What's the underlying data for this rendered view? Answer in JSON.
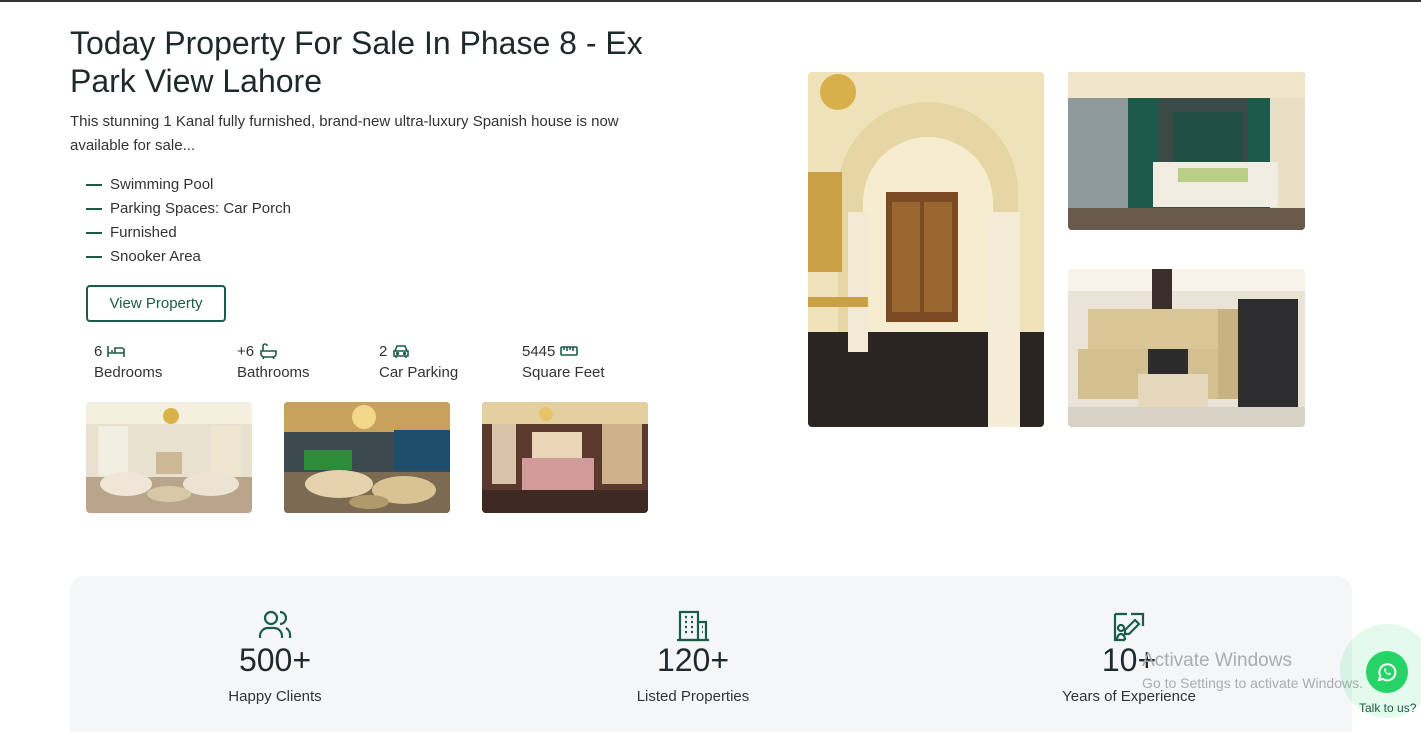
{
  "listing": {
    "title": "Today Property For Sale In Phase 8 - Ex Park View Lahore",
    "description": "This stunning 1 Kanal fully furnished, brand-new ultra-luxury Spanish house is now available for sale...",
    "features": [
      "Swimming Pool",
      "Parking Spaces: Car Porch",
      "Furnished",
      "Snooker Area"
    ],
    "view_button": "View Property",
    "stats": [
      {
        "value": "6",
        "label": "Bedrooms",
        "icon": "bed-icon"
      },
      {
        "value": "+6",
        "label": "Bathrooms",
        "icon": "bathtub-icon"
      },
      {
        "value": "2",
        "label": "Car Parking",
        "icon": "car-icon"
      },
      {
        "value": "5445",
        "label": "Square Feet",
        "icon": "ruler-icon"
      }
    ],
    "thumbnails": [
      "living-room",
      "snooker-lounge",
      "master-bedroom"
    ],
    "gallery": [
      "arched-hallway",
      "green-bedroom",
      "kitchen"
    ]
  },
  "counters": [
    {
      "value": "500+",
      "label": "Happy Clients",
      "icon": "users-icon"
    },
    {
      "value": "120+",
      "label": "Listed Properties",
      "icon": "building-icon"
    },
    {
      "value": "10+",
      "label": "Years of Experience",
      "icon": "certificate-icon"
    }
  ],
  "overlay": {
    "activate_title": "Activate Windows",
    "activate_sub": "Go to Settings to activate Windows."
  },
  "whatsapp": {
    "talk_label": "Talk to us?"
  },
  "colors": {
    "brand_green": "#1a5c4a",
    "whatsapp_green": "#25d366",
    "panel_bg": "#f4f6f7"
  }
}
